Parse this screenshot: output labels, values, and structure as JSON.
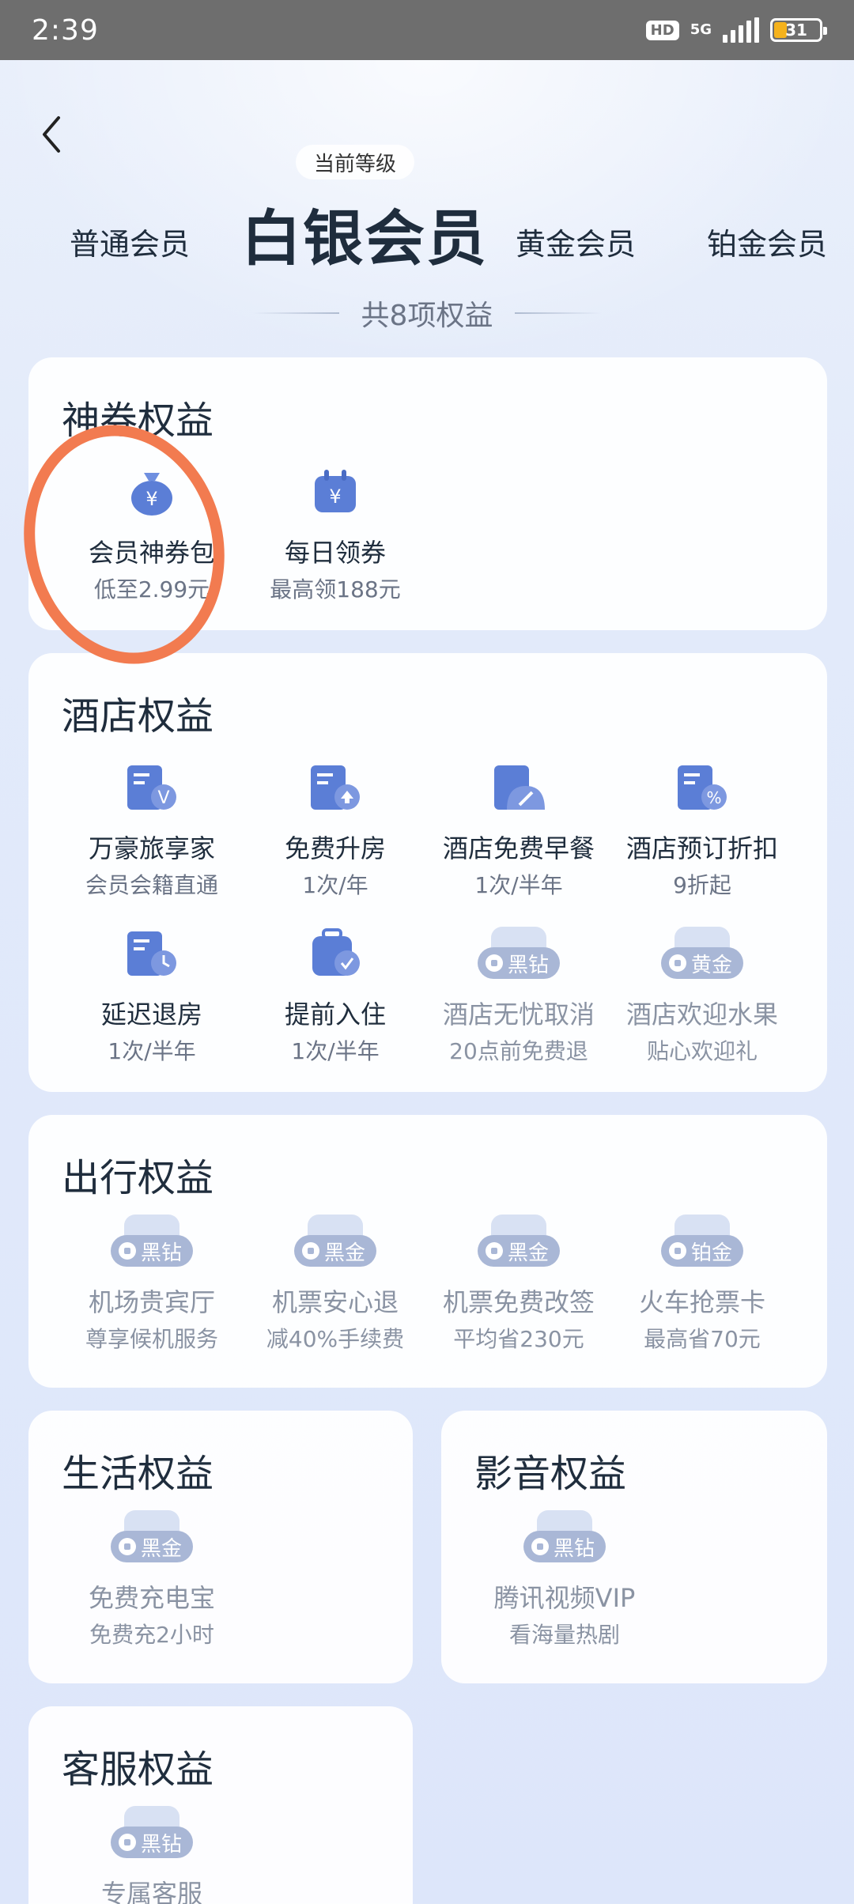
{
  "status_bar": {
    "time": "2:39",
    "hd": "HD",
    "network": "5G",
    "battery": "31"
  },
  "header": {
    "current_tag": "当前等级",
    "tiers": [
      "普通会员",
      "白银会员",
      "黄金会员",
      "铂金会员"
    ],
    "count_text": "共8项权益"
  },
  "sections": {
    "coupon": {
      "title": "神券权益",
      "items": [
        {
          "name": "会员神券包",
          "sub": "低至2.99元",
          "icon": "coupon-bag-icon"
        },
        {
          "name": "每日领券",
          "sub": "最高领188元",
          "icon": "daily-coupon-icon"
        }
      ]
    },
    "hotel": {
      "title": "酒店权益",
      "items": [
        {
          "name": "万豪旅享家",
          "sub": "会员会籍直通",
          "icon": "hotel-v-icon"
        },
        {
          "name": "免费升房",
          "sub": "1次/年",
          "icon": "room-upgrade-icon"
        },
        {
          "name": "酒店免费早餐",
          "sub": "1次/半年",
          "icon": "breakfast-icon"
        },
        {
          "name": "酒店预订折扣",
          "sub": "9折起",
          "icon": "discount-icon"
        },
        {
          "name": "延迟退房",
          "sub": "1次/半年",
          "icon": "late-checkout-icon"
        },
        {
          "name": "提前入住",
          "sub": "1次/半年",
          "icon": "early-checkin-icon"
        },
        {
          "name": "酒店无忧取消",
          "sub": "20点前免费退",
          "badge": "黑钻"
        },
        {
          "name": "酒店欢迎水果",
          "sub": "贴心欢迎礼",
          "badge": "黄金"
        }
      ]
    },
    "travel": {
      "title": "出行权益",
      "items": [
        {
          "name": "机场贵宾厅",
          "sub": "尊享候机服务",
          "badge": "黑钻"
        },
        {
          "name": "机票安心退",
          "sub": "减40%手续费",
          "badge": "黑金"
        },
        {
          "name": "机票免费改签",
          "sub": "平均省230元",
          "badge": "黑金"
        },
        {
          "name": "火车抢票卡",
          "sub": "最高省70元",
          "badge": "铂金"
        }
      ]
    },
    "life": {
      "title": "生活权益",
      "items": [
        {
          "name": "免费充电宝",
          "sub": "免费充2小时",
          "badge": "黑金"
        }
      ]
    },
    "media": {
      "title": "影音权益",
      "items": [
        {
          "name": "腾讯视频VIP",
          "sub": "看海量热剧",
          "badge": "黑钻"
        }
      ]
    },
    "service": {
      "title": "客服权益",
      "items": [
        {
          "name": "专属客服",
          "sub": "",
          "badge": "黑钻"
        }
      ]
    }
  },
  "colors": {
    "annotation_circle": "#f27b50",
    "icon_blue": "#5b7ed6",
    "lock_badge": "#a9b7d6"
  }
}
